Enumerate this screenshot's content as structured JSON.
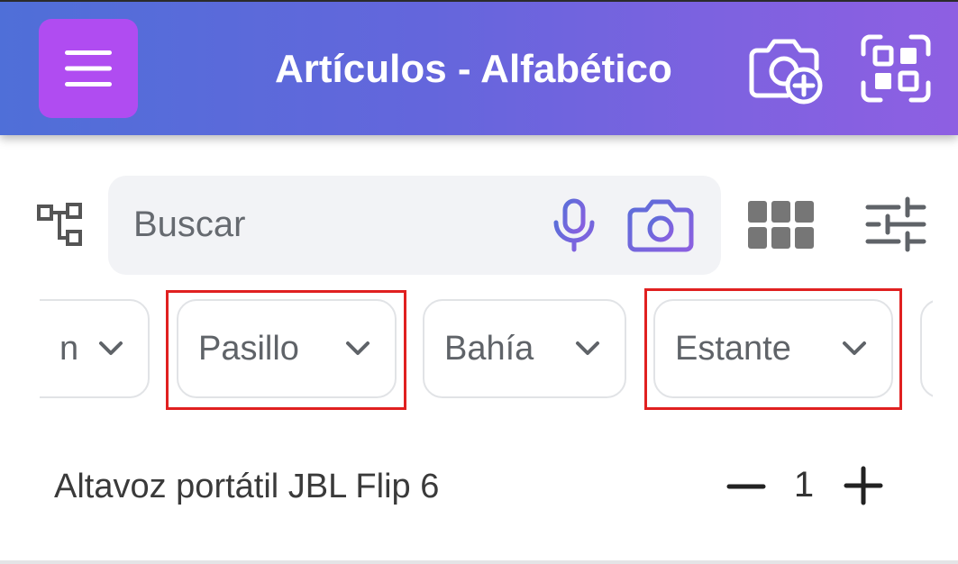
{
  "header": {
    "title": "Artículos - Alfabético",
    "menu_icon": "menu-icon",
    "add_photo_icon": "camera-plus-icon",
    "scan_icon": "qr-scan-icon",
    "background_colors": [
      "#4f6fd8",
      "#8e5fe2"
    ],
    "menu_button_color": "#b04cf1"
  },
  "toolbar": {
    "hierarchy_icon": "hierarchy-icon",
    "search": {
      "placeholder": "Buscar",
      "value": ""
    },
    "mic_icon": "microphone-icon",
    "camera_icon": "camera-icon",
    "grid_icon": "grid-view-icon",
    "filter_icon": "sliders-icon"
  },
  "filters": {
    "chips": [
      {
        "label": "n",
        "icon": "chevron-down-icon"
      },
      {
        "label": "Pasillo",
        "icon": "chevron-down-icon"
      },
      {
        "label": "Bahía",
        "icon": "chevron-down-icon"
      },
      {
        "label": "Estante",
        "icon": "chevron-down-icon"
      },
      {
        "label": "",
        "icon": ""
      }
    ],
    "highlight_color": "#e02020"
  },
  "items": [
    {
      "name": "Altavoz portátil JBL Flip 6",
      "quantity": "1",
      "minus_icon": "minus-icon",
      "plus_icon": "plus-icon"
    }
  ]
}
